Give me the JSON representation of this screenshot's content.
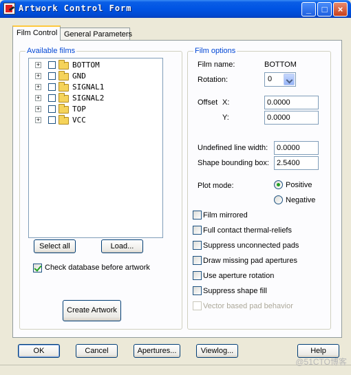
{
  "window": {
    "title": "Artwork Control Form",
    "controls": {
      "minimize": "_",
      "maximize": "□",
      "close": "×"
    }
  },
  "tabs": [
    {
      "label": "Film Control",
      "active": true
    },
    {
      "label": "General Parameters",
      "active": false
    }
  ],
  "available_films": {
    "legend": "Available films",
    "items": [
      {
        "label": "BOTTOM"
      },
      {
        "label": "GND"
      },
      {
        "label": "SIGNAL1"
      },
      {
        "label": "SIGNAL2"
      },
      {
        "label": "TOP"
      },
      {
        "label": "VCC"
      }
    ],
    "select_all_label": "Select all",
    "load_label": "Load...",
    "check_db_label": "Check database before artwork",
    "check_db_checked": true,
    "create_artwork_label": "Create Artwork"
  },
  "film_options": {
    "legend": "Film options",
    "film_name_label": "Film name:",
    "film_name_value": "BOTTOM",
    "rotation_label": "Rotation:",
    "rotation_value": "0",
    "offset_label": "Offset",
    "offset_x_label": "X:",
    "offset_x_value": "0.0000",
    "offset_y_label": "Y:",
    "offset_y_value": "0.0000",
    "undefined_line_width_label": "Undefined line width:",
    "undefined_line_width_value": "0.0000",
    "shape_bounding_box_label": "Shape bounding box:",
    "shape_bounding_box_value": "2.5400",
    "plot_mode_label": "Plot mode:",
    "positive_label": "Positive",
    "negative_label": "Negative",
    "plot_mode_selected": "Positive",
    "checkboxes": [
      {
        "label": "Film mirrored",
        "checked": false,
        "enabled": true
      },
      {
        "label": "Full contact thermal-reliefs",
        "checked": false,
        "enabled": true
      },
      {
        "label": "Suppress unconnected pads",
        "checked": false,
        "enabled": true
      },
      {
        "label": "Draw missing pad apertures",
        "checked": false,
        "enabled": true
      },
      {
        "label": "Use aperture rotation",
        "checked": false,
        "enabled": true
      },
      {
        "label": "Suppress shape fill",
        "checked": false,
        "enabled": true
      },
      {
        "label": "Vector based pad behavior",
        "checked": false,
        "enabled": false
      }
    ]
  },
  "footer": {
    "ok_label": "OK",
    "cancel_label": "Cancel",
    "apertures_label": "Apertures...",
    "viewlog_label": "Viewlog...",
    "help_label": "Help"
  },
  "watermark": "@51CTO博客",
  "colors": {
    "titlebar": "#0054e3",
    "legend_text": "#0046d5",
    "dialog_bg": "#ece9d8",
    "check_mark": "#21a121"
  }
}
